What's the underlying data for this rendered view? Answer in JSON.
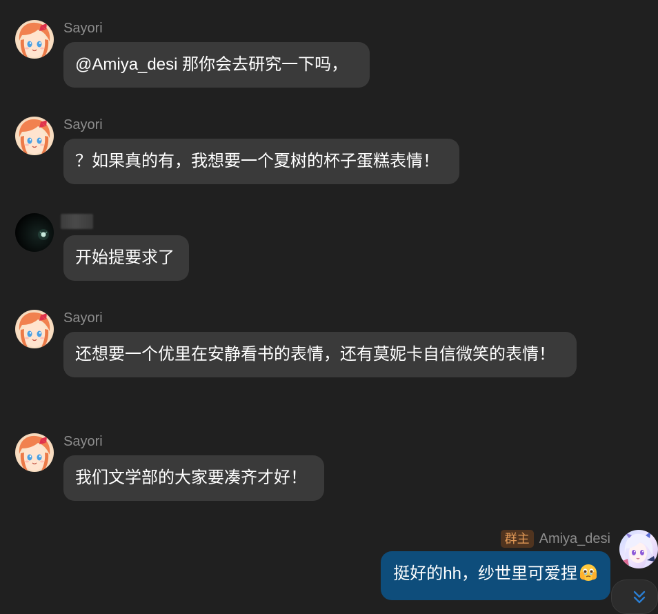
{
  "messages": [
    {
      "sender": "Sayori",
      "text": "@Amiya_desi 那你会去研究一下吗，"
    },
    {
      "sender": "Sayori",
      "text": "？如果真的有，我想要一个夏树的杯子蛋糕表情！"
    },
    {
      "sender": "",
      "text": "开始提要求了"
    },
    {
      "sender": "Sayori",
      "text": "还想要一个优里在安静看书的表情，还有莫妮卡自信微笑的表情！"
    },
    {
      "sender": "Sayori",
      "text": "我们文学部的大家要凑齐才好！"
    }
  ],
  "own_message": {
    "badge": "群主",
    "sender": "Amiya_desi",
    "text": "挺好的hh，纱世里可爱捏",
    "emoji": "face-holding-back-tears"
  },
  "icons": {
    "scroll_down": "double-chevron-down-icon"
  },
  "colors": {
    "background": "#202020",
    "incoming_bubble": "#3a3a3a",
    "outgoing_bubble": "#0e4d7b",
    "badge_bg": "#50341f",
    "badge_text": "#e39a57"
  }
}
